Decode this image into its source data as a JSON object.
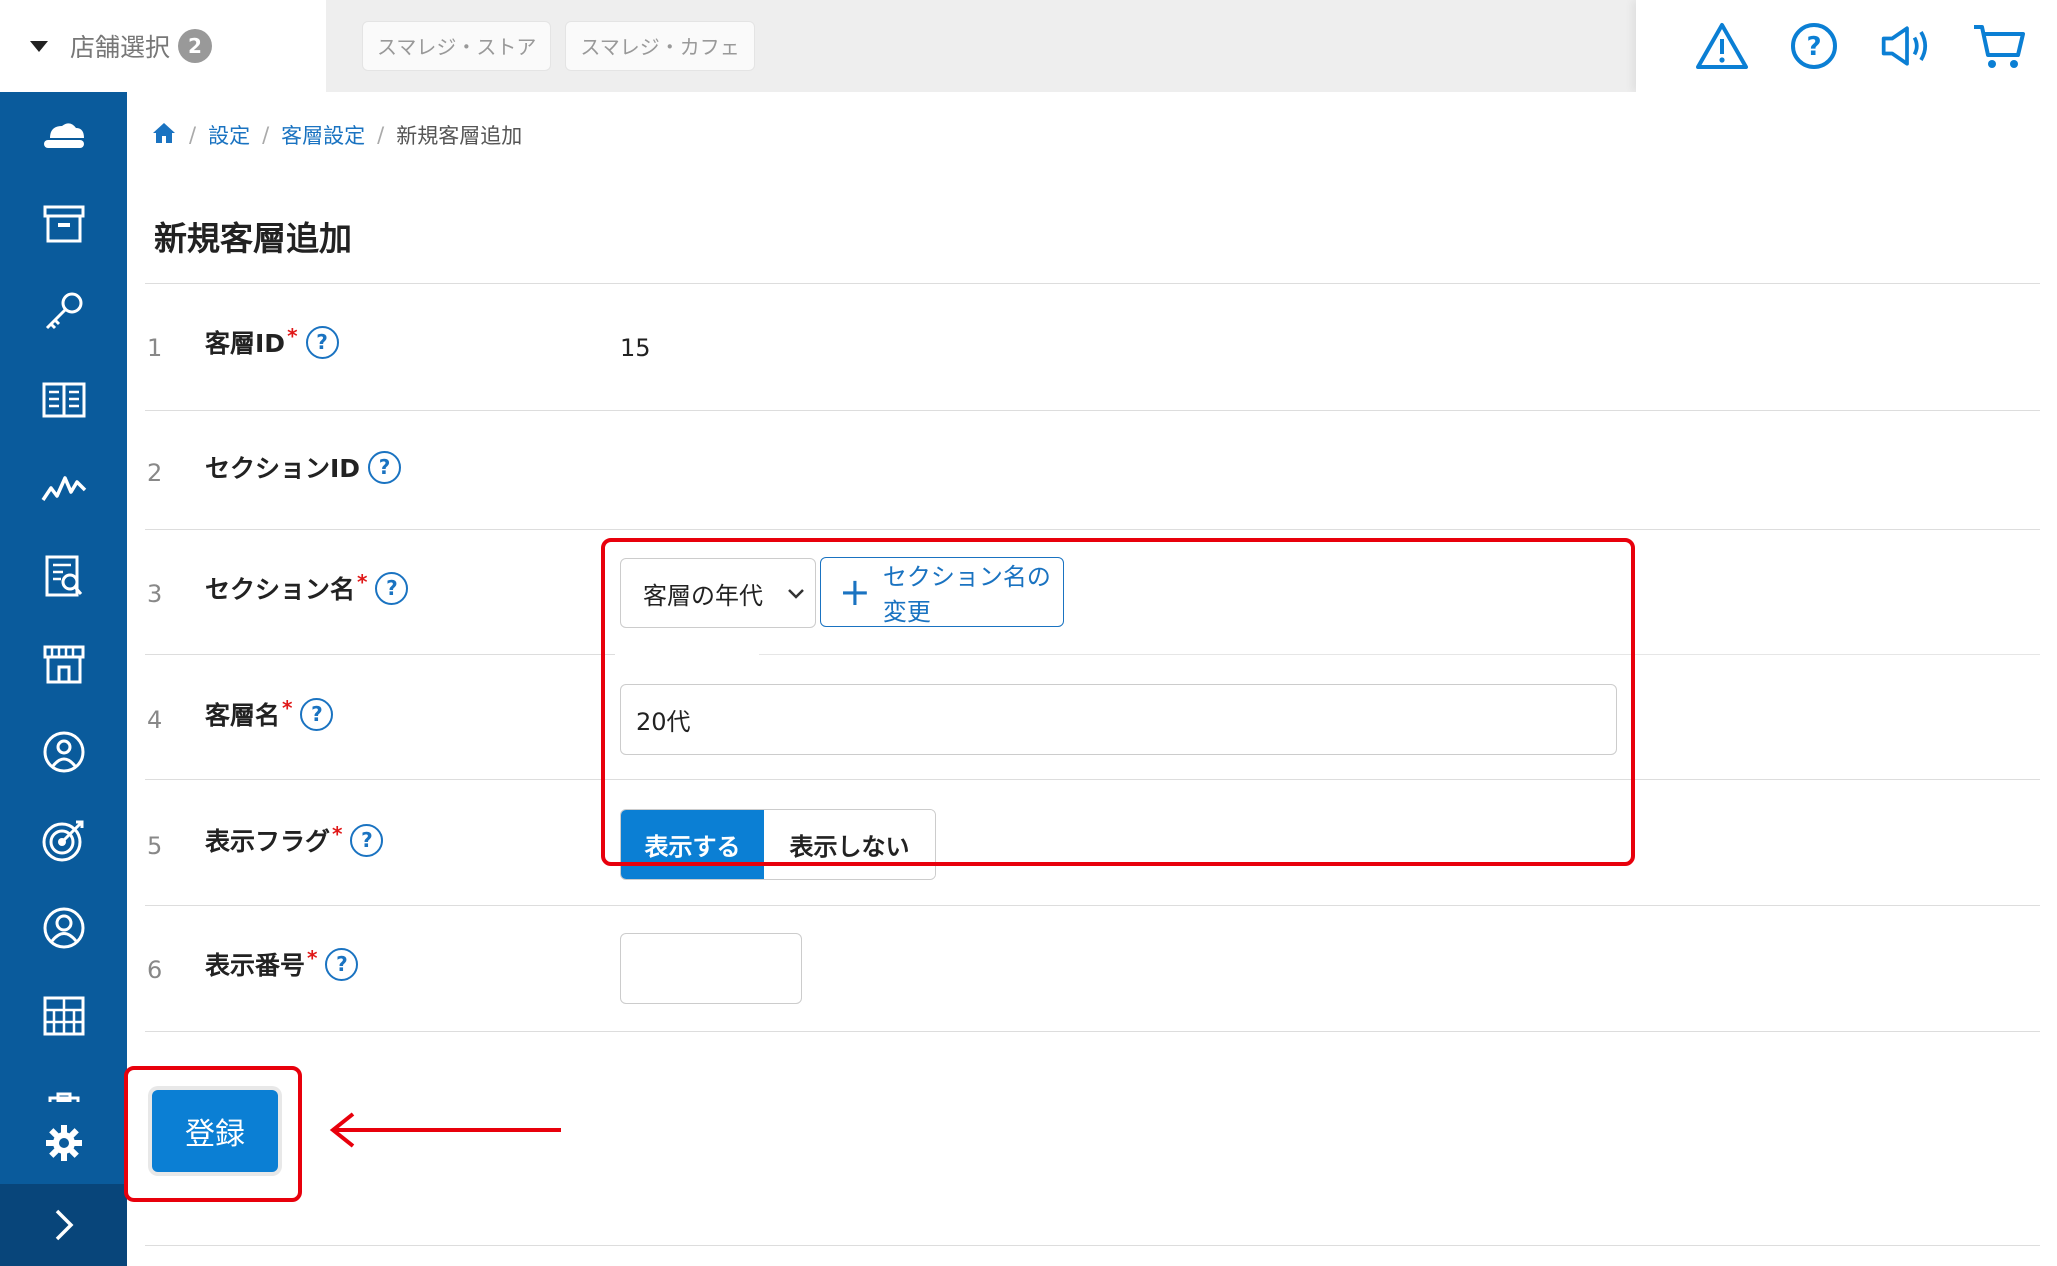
{
  "topbar": {
    "store_select_label": "店舗選択",
    "store_count": "2",
    "store_tabs": [
      "スマレジ・ストア",
      "スマレジ・カフェ"
    ],
    "icons": [
      "warning-icon",
      "help-icon",
      "megaphone-icon",
      "cart-icon"
    ]
  },
  "sidebar": {
    "items": [
      "cloud-icon",
      "archive-icon",
      "key-icon",
      "book-icon",
      "chart-icon",
      "report-icon",
      "store-icon",
      "customer-icon",
      "target-icon",
      "user-icon",
      "grid-icon",
      "clipboard-icon",
      "gear-icon",
      "chevron-right-icon"
    ]
  },
  "breadcrumb": {
    "home": "home-icon",
    "items": [
      "設定",
      "客層設定",
      "新規客層追加"
    ],
    "separator": "/"
  },
  "page": {
    "title": "新規客層追加"
  },
  "form": {
    "required_mark": "*",
    "help_mark": "?",
    "rows": [
      {
        "num": "1",
        "label": "客層ID",
        "required": true,
        "value": "15"
      },
      {
        "num": "2",
        "label": "セクションID",
        "required": false,
        "value": ""
      },
      {
        "num": "3",
        "label": "セクション名",
        "required": true
      },
      {
        "num": "4",
        "label": "客層名",
        "required": true
      },
      {
        "num": "5",
        "label": "表示フラグ",
        "required": true
      },
      {
        "num": "6",
        "label": "表示番号",
        "required": true
      }
    ],
    "section_select": "客層の年代",
    "change_section_button": "セクション名の変更",
    "plus": "+",
    "customer_name_value": "20代",
    "flag_on": "表示する",
    "flag_off": "表示しない",
    "display_number_value": ""
  },
  "submit_label": "登録",
  "colors": {
    "sidebar": "#0a5b9c",
    "primary": "#0b7fd4",
    "link": "#1a73c1",
    "highlight": "#e8000c"
  }
}
